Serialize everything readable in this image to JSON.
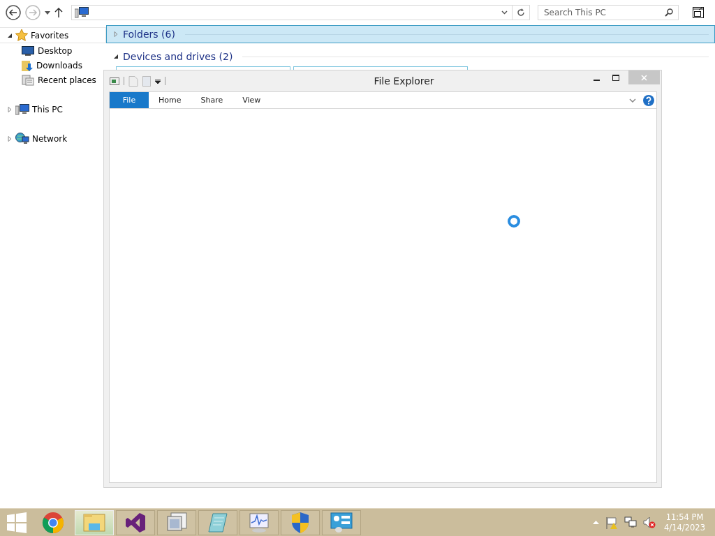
{
  "explorer": {
    "search": {
      "placeholder": "Search This PC"
    },
    "nav_tree": [
      {
        "label": "Favorites",
        "kind": "favorites",
        "expanded": true,
        "children": [
          {
            "label": "Desktop",
            "kind": "desktop"
          },
          {
            "label": "Downloads",
            "kind": "downloads"
          },
          {
            "label": "Recent places",
            "kind": "recent"
          }
        ]
      },
      {
        "label": "This PC",
        "kind": "pc",
        "expanded": false
      },
      {
        "label": "Network",
        "kind": "network",
        "expanded": false
      }
    ],
    "groups": [
      {
        "label": "Folders (6)",
        "expanded": false,
        "selected": true
      },
      {
        "label": "Devices and drives (2)",
        "expanded": true,
        "selected": false
      }
    ]
  },
  "window": {
    "title": "File Explorer",
    "loading": true,
    "ribbon_tabs": [
      {
        "label": "File",
        "selected": true
      },
      {
        "label": "Home",
        "selected": false
      },
      {
        "label": "Share",
        "selected": false
      },
      {
        "label": "View",
        "selected": false
      }
    ]
  },
  "taskbar": {
    "apps": [
      {
        "kind": "chrome",
        "selected": false
      },
      {
        "kind": "explorer",
        "selected": true
      },
      {
        "kind": "studio",
        "selected": false
      },
      {
        "kind": "windows",
        "selected": false
      },
      {
        "kind": "notepad",
        "selected": false
      },
      {
        "kind": "monitor",
        "selected": false
      },
      {
        "kind": "shield",
        "selected": false
      },
      {
        "kind": "panel",
        "selected": false
      }
    ],
    "clock": {
      "time": "11:54 PM",
      "date": "4/14/2023"
    }
  }
}
